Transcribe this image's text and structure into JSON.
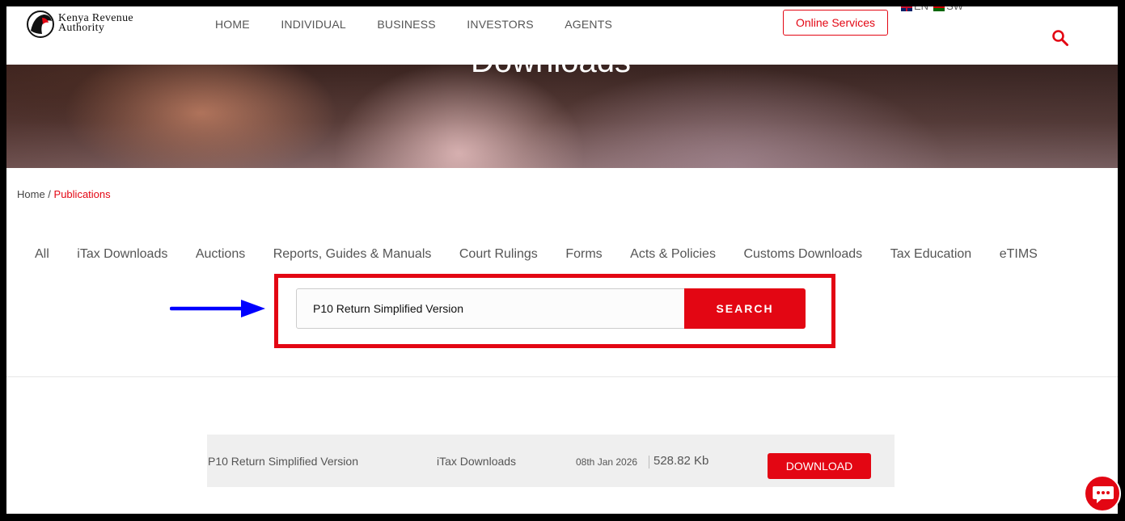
{
  "header": {
    "logo_line1": "Kenya Revenue",
    "logo_line2": "Authority",
    "nav": [
      "HOME",
      "INDIVIDUAL",
      "BUSINESS",
      "INVESTORS",
      "AGENTS"
    ],
    "online_services": "Online Services",
    "lang_en": "EN",
    "lang_sw": "SW",
    "search_icon": "search-icon"
  },
  "hero": {
    "title": "Downloads"
  },
  "breadcrumb": {
    "home": "Home",
    "separator": " / ",
    "current": "Publications"
  },
  "categories": [
    "All",
    "iTax Downloads",
    "Auctions",
    "Reports, Guides & Manuals",
    "Court Rulings",
    "Forms",
    "Acts & Policies",
    "Customs Downloads",
    "Tax Education",
    "eTIMS"
  ],
  "search": {
    "value": "P10 Return Simplified Version",
    "button": "SEARCH"
  },
  "result": {
    "title": "P10 Return Simplified Version",
    "category": "iTax Downloads",
    "date": "08th Jan 2026",
    "size": "528.82 Kb",
    "download": "DOWNLOAD"
  },
  "colors": {
    "brand_red": "#e30613",
    "annotation_arrow": "#0000ff"
  }
}
